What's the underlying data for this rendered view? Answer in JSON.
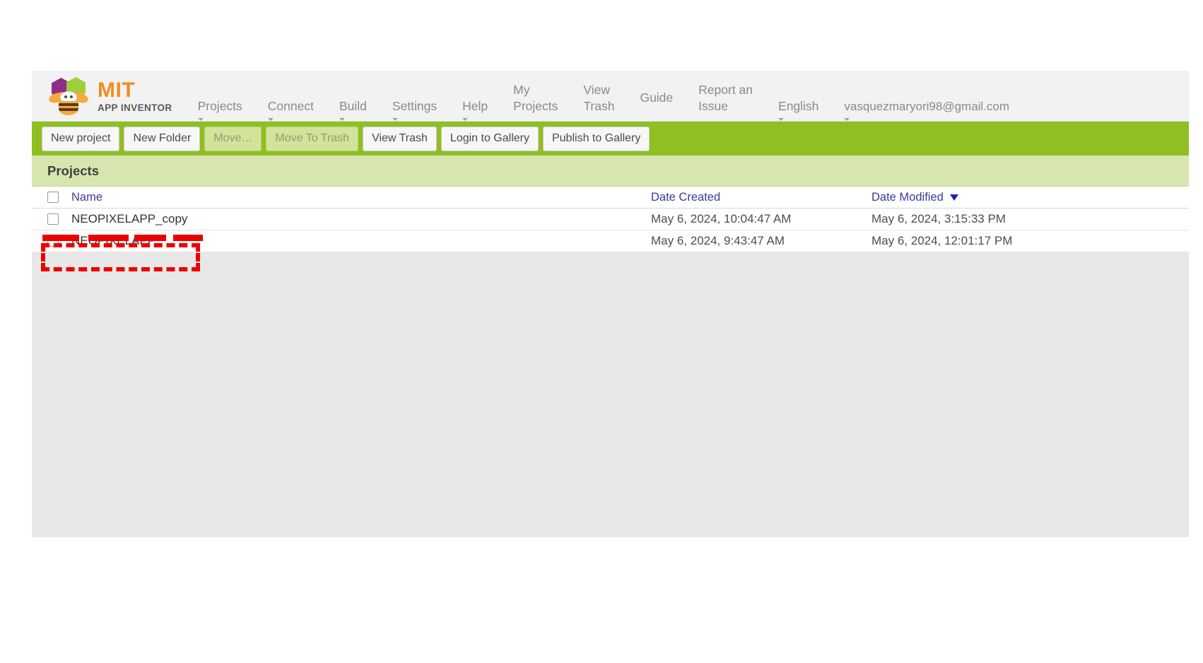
{
  "brand": {
    "logo_primary": "MIT",
    "logo_secondary": "APP INVENTOR",
    "logo_icon": "app-inventor-bee-logo"
  },
  "topnav": {
    "items": [
      {
        "label": "Projects",
        "has_caret": true
      },
      {
        "label": "Connect",
        "has_caret": true
      },
      {
        "label": "Build",
        "has_caret": true
      },
      {
        "label": "Settings",
        "has_caret": true
      },
      {
        "label": "Help",
        "has_caret": true
      },
      {
        "label": "My\nProjects",
        "has_caret": false
      },
      {
        "label": "View\nTrash",
        "has_caret": false
      },
      {
        "label": "Guide",
        "has_caret": false
      },
      {
        "label": "Report an\nIssue",
        "has_caret": false
      },
      {
        "label": "English",
        "has_caret": true
      },
      {
        "label": "vasquezmaryori98@gmail.com",
        "has_caret": true
      }
    ]
  },
  "actionbar": {
    "buttons": [
      {
        "label": "New project",
        "disabled": false
      },
      {
        "label": "New Folder",
        "disabled": false
      },
      {
        "label": "Move…",
        "disabled": true
      },
      {
        "label": "Move To Trash",
        "disabled": true
      },
      {
        "label": "View Trash",
        "disabled": false
      },
      {
        "label": "Login to Gallery",
        "disabled": false
      },
      {
        "label": "Publish to Gallery",
        "disabled": false
      }
    ]
  },
  "panel": {
    "title": "Projects"
  },
  "table": {
    "columns": {
      "name": "Name",
      "date_created": "Date Created",
      "date_modified": "Date Modified"
    },
    "sort": {
      "column": "Date Modified",
      "direction": "descending",
      "icon": "caret-down-icon"
    },
    "rows": [
      {
        "name": "NEOPIXELAPP_copy",
        "date_created": "May 6, 2024, 10:04:47 AM",
        "date_modified": "May 6, 2024, 3:15:33 PM",
        "checked": false
      },
      {
        "name": "NEOPIXELAPP",
        "date_created": "May 6, 2024, 9:43:47 AM",
        "date_modified": "May 6, 2024, 12:01:17 PM",
        "checked": false
      }
    ]
  },
  "annotations": {
    "accent_color": "#ee0000",
    "redaction_bars": 4,
    "highlight_box_target": "NEOPIXELAPP"
  },
  "colors": {
    "actionbar_green": "#8fbf21",
    "panel_green": "#d7e6ae",
    "brand_orange": "#f08c1e",
    "link_blue": "#3a3a9e"
  }
}
